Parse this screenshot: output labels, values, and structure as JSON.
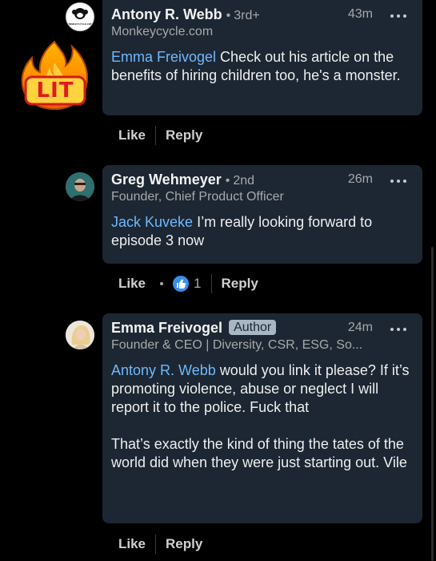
{
  "comments": [
    {
      "name": "Antony R. Webb",
      "degree": "3rd+",
      "subtitle": "Monkeycycle.com",
      "time": "43m",
      "mention": "Emma Freivogel",
      "text": " Check out his article on the benefits of hiring children too, he's a monster.",
      "like_label": "Like",
      "reply_label": "Reply",
      "avatar_label": "MONKEYCYCLE.COM"
    },
    {
      "name": "Greg Wehmeyer",
      "degree": "2nd",
      "subtitle": "Founder, Chief Product Officer",
      "time": "26m",
      "mention": "Jack Kuveke",
      "text": " I’m really looking forward to episode 3 now",
      "like_label": "Like",
      "reaction_count": "1",
      "reply_label": "Reply"
    },
    {
      "name": "Emma Freivogel",
      "badge": "Author",
      "subtitle": "Founder & CEO | Diversity, CSR, ESG, So...",
      "time": "24m",
      "mention": "Antony R. Webb",
      "text": " would you link it please? If it’s promoting violence, abuse or neglect I will report it to the police. Fuck that\n\nThat’s exactly the kind of thing the tates of the world did when they were just starting out. Vile",
      "like_label": "Like",
      "reply_label": "Reply"
    }
  ],
  "sticker": {
    "text": "LIT"
  },
  "icons": {
    "more": "more-horizontal-icon",
    "like_reaction": "thumbs-up-icon",
    "sticker": "fire-lit-icon"
  },
  "colors": {
    "background": "#000000",
    "bubble": "#1c2733",
    "mention": "#71b7fb",
    "secondary_text": "#a8a8a8",
    "like_blue": "#378fe9"
  }
}
